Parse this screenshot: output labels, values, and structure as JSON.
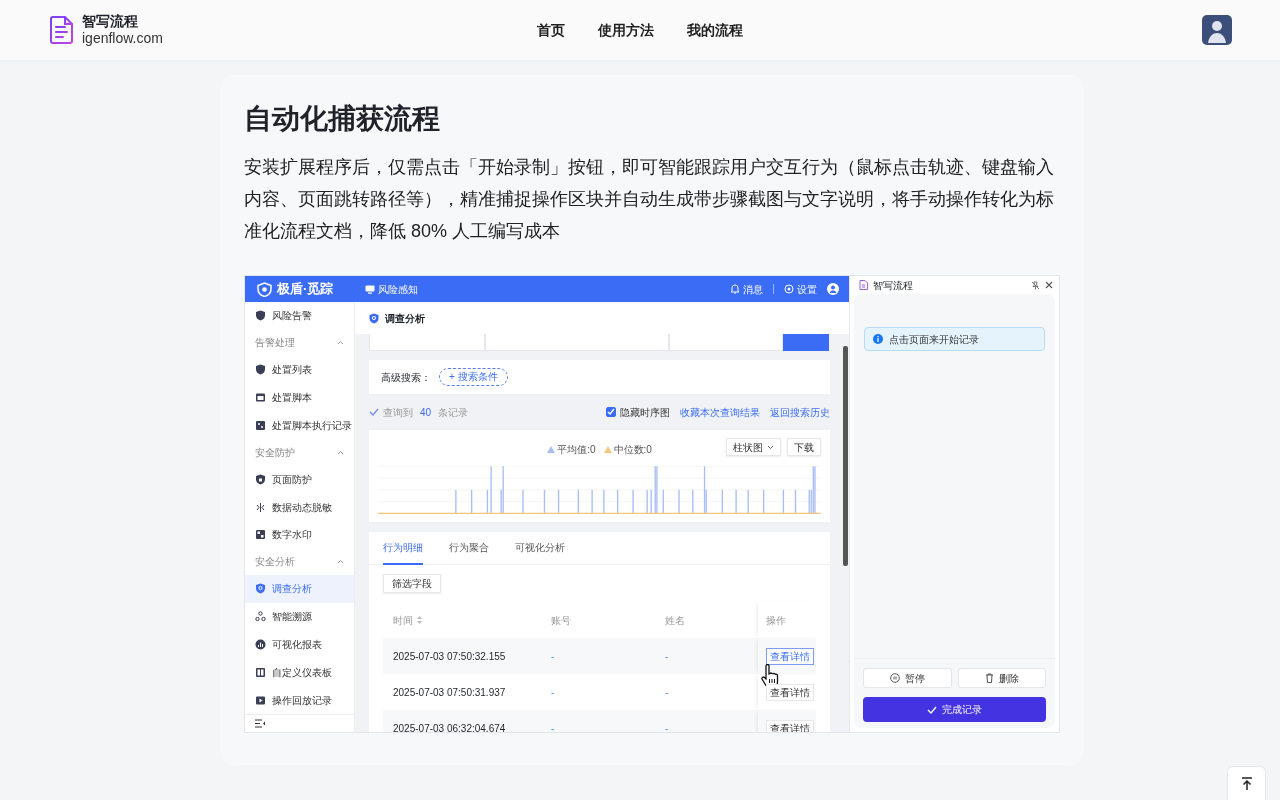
{
  "header": {
    "brand": "智写流程",
    "domain": "igenflow.com",
    "nav": [
      {
        "label": "首页"
      },
      {
        "label": "使用方法"
      },
      {
        "label": "我的流程"
      }
    ]
  },
  "hero": {
    "title": "自动化捕获流程",
    "description": "安装扩展程序后，仅需点击「开始录制」按钮，即可智能跟踪用户交互行为（鼠标点击轨迹、键盘输入内容、页面跳转路径等），精准捕捉操作区块并自动生成带步骤截图与文字说明，将手动操作转化为标准化流程文档，降低 80% 人工编写成本"
  },
  "demo_app": {
    "brand": "极盾·觅踪",
    "module": "风险感知",
    "top_actions": [
      {
        "label": "消息"
      },
      {
        "label": "设置"
      }
    ],
    "sidebar": [
      {
        "kind": "item",
        "label": "风险告警",
        "selected": false
      },
      {
        "kind": "section",
        "label": "告警处理",
        "expanded": true
      },
      {
        "kind": "item",
        "label": "处置列表",
        "selected": false
      },
      {
        "kind": "item",
        "label": "处置脚本",
        "selected": false
      },
      {
        "kind": "item",
        "label": "处置脚本执行记录",
        "selected": false
      },
      {
        "kind": "section",
        "label": "安全防护",
        "expanded": true
      },
      {
        "kind": "item",
        "label": "页面防护",
        "selected": false
      },
      {
        "kind": "item",
        "label": "数据动态脱敏",
        "selected": false
      },
      {
        "kind": "item",
        "label": "数字水印",
        "selected": false
      },
      {
        "kind": "section",
        "label": "安全分析",
        "expanded": true
      },
      {
        "kind": "item",
        "label": "调查分析",
        "selected": true
      },
      {
        "kind": "item",
        "label": "智能溯源",
        "selected": false
      },
      {
        "kind": "item",
        "label": "可视化报表",
        "selected": false
      },
      {
        "kind": "item",
        "label": "自定义仪表板",
        "selected": false
      },
      {
        "kind": "item",
        "label": "操作回放记录",
        "selected": false
      }
    ],
    "page_title": "调查分析",
    "advanced_search": {
      "label": "高级搜索：",
      "button": "+ 搜索条件"
    },
    "result": {
      "prefix": "查询到",
      "count": "40",
      "suffix": "条记录"
    },
    "hide_timeline": {
      "label": "隐藏时序图",
      "checked": true
    },
    "links": [
      {
        "label": "收藏本次查询结果"
      },
      {
        "label": "返回搜索历史"
      }
    ],
    "chart": {
      "legend": [
        {
          "label": "平均值:0",
          "color": "#a9bdf5"
        },
        {
          "label": "中位数:0",
          "color": "#f7c77e"
        }
      ],
      "chart_type": "柱状图",
      "download": "下载"
    },
    "tabs": [
      {
        "label": "行为明细",
        "selected": true
      },
      {
        "label": "行为聚合",
        "selected": false
      },
      {
        "label": "可视化分析",
        "selected": false
      }
    ],
    "filter_button": "筛选字段",
    "table": {
      "columns": [
        {
          "label": "时间",
          "sortable": true
        },
        {
          "label": "账号",
          "sortable": false
        },
        {
          "label": "姓名",
          "sortable": false
        },
        {
          "label": "操作",
          "sortable": false
        }
      ],
      "rows": [
        {
          "time": "2025-07-03 07:50:32.155",
          "account": "-",
          "name": "-",
          "action": "查看详情",
          "hovered": true
        },
        {
          "time": "2025-07-03 07:50:31.937",
          "account": "-",
          "name": "-",
          "action": "查看详情",
          "hovered": false
        },
        {
          "time": "2025-07-03 06:32:04.674",
          "account": "-",
          "name": "-",
          "action": "查看详情",
          "hovered": false
        }
      ]
    }
  },
  "recorder": {
    "title": "智写流程",
    "notice": "点击页面来开始记录",
    "pause": "暂停",
    "delete": "删除",
    "finish": "完成记录"
  }
}
